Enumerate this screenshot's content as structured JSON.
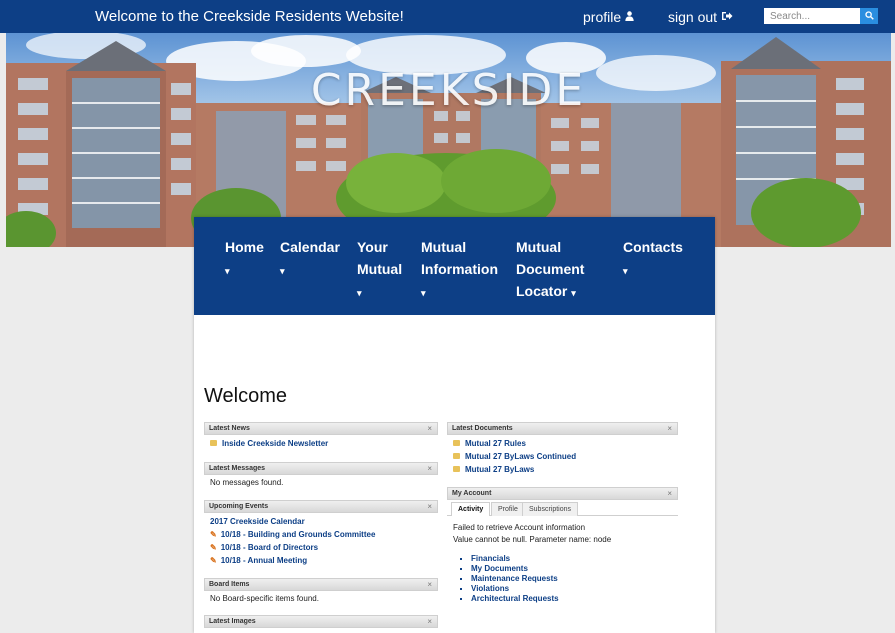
{
  "topbar": {
    "welcome": "Welcome to the Creekside Residents Website!",
    "profile_label": "profile",
    "signout_label": "sign out",
    "search_placeholder": "Search...",
    "profile_icon": "user-icon",
    "signout_icon": "sign-out-icon",
    "search_icon": "search-icon"
  },
  "hero": {
    "title": "CREEKSIDE"
  },
  "nav": [
    {
      "lines": [
        "Home",
        ""
      ],
      "caret": "▾"
    },
    {
      "lines": [
        "Calendar",
        ""
      ],
      "caret": "▾"
    },
    {
      "lines": [
        "Your",
        "Mutual",
        ""
      ],
      "caret": "▾"
    },
    {
      "lines": [
        "Mutual",
        "Information",
        ""
      ],
      "caret": "▾"
    },
    {
      "lines": [
        "Mutual",
        "Document",
        "Locator"
      ],
      "caret": "▾"
    },
    {
      "lines": [
        "Contacts",
        ""
      ],
      "caret": "▾"
    }
  ],
  "page_title": "Welcome",
  "latest_news": {
    "title": "Latest News",
    "items": [
      "Inside Creekside Newsletter"
    ]
  },
  "latest_messages": {
    "title": "Latest Messages",
    "empty": "No messages found."
  },
  "upcoming_events": {
    "title": "Upcoming Events",
    "calendar": "2017 Creekside Calendar",
    "items": [
      "10/18 - Building and Grounds Committee",
      "10/18 - Board of Directors",
      "10/18 - Annual Meeting"
    ]
  },
  "board_items": {
    "title": "Board Items",
    "empty": "No Board-specific items found."
  },
  "latest_images": {
    "title": "Latest Images"
  },
  "latest_documents": {
    "title": "Latest Documents",
    "items": [
      "Mutual 27 Rules",
      "Mutual 27 ByLaws Continued",
      "Mutual 27 ByLaws"
    ]
  },
  "my_account": {
    "title": "My Account",
    "tabs": [
      "Activity",
      "Profile",
      "Subscriptions"
    ],
    "error1": "Failed to retrieve Account information",
    "error2": "Value cannot be null. Parameter name: node",
    "links": [
      "Financials",
      "My Documents",
      "Maintenance Requests",
      "Violations",
      "Architectural Requests"
    ]
  },
  "close_glyph": "×",
  "colors": {
    "brand": "#0d3f86",
    "search_button": "#2a8ee0"
  }
}
